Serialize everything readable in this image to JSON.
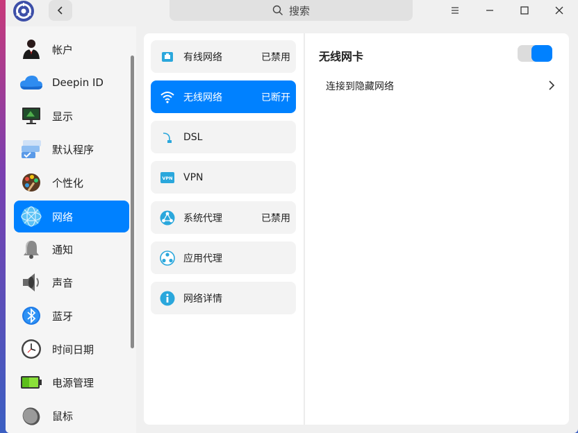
{
  "search": {
    "placeholder": "搜索"
  },
  "sidebar": {
    "items": [
      {
        "label": "帐户",
        "icon": "user-icon"
      },
      {
        "label": "Deepin ID",
        "icon": "cloud-icon"
      },
      {
        "label": "显示",
        "icon": "monitor-icon"
      },
      {
        "label": "默认程序",
        "icon": "default-apps-icon"
      },
      {
        "label": "个性化",
        "icon": "palette-icon"
      },
      {
        "label": "网络",
        "icon": "network-globe-icon",
        "active": true
      },
      {
        "label": "通知",
        "icon": "bell-icon"
      },
      {
        "label": "声音",
        "icon": "speaker-icon"
      },
      {
        "label": "蓝牙",
        "icon": "bluetooth-icon"
      },
      {
        "label": "时间日期",
        "icon": "clock-icon"
      },
      {
        "label": "电源管理",
        "icon": "battery-icon"
      },
      {
        "label": "鼠标",
        "icon": "mouse-icon"
      }
    ]
  },
  "network": {
    "items": [
      {
        "label": "有线网络",
        "status": "已禁用",
        "icon": "wired-icon"
      },
      {
        "label": "无线网络",
        "status": "已断开",
        "icon": "wifi-icon",
        "active": true
      },
      {
        "label": "DSL",
        "status": "",
        "icon": "dsl-icon"
      },
      {
        "label": "VPN",
        "status": "",
        "icon": "vpn-icon"
      },
      {
        "label": "系统代理",
        "status": "已禁用",
        "icon": "system-proxy-icon"
      },
      {
        "label": "应用代理",
        "status": "",
        "icon": "app-proxy-icon"
      },
      {
        "label": "网络详情",
        "status": "",
        "icon": "info-icon"
      }
    ]
  },
  "wireless": {
    "title": "无线网卡",
    "enabled": true,
    "hidden_network_label": "连接到隐藏网络"
  },
  "colors": {
    "accent": "#0081ff"
  }
}
